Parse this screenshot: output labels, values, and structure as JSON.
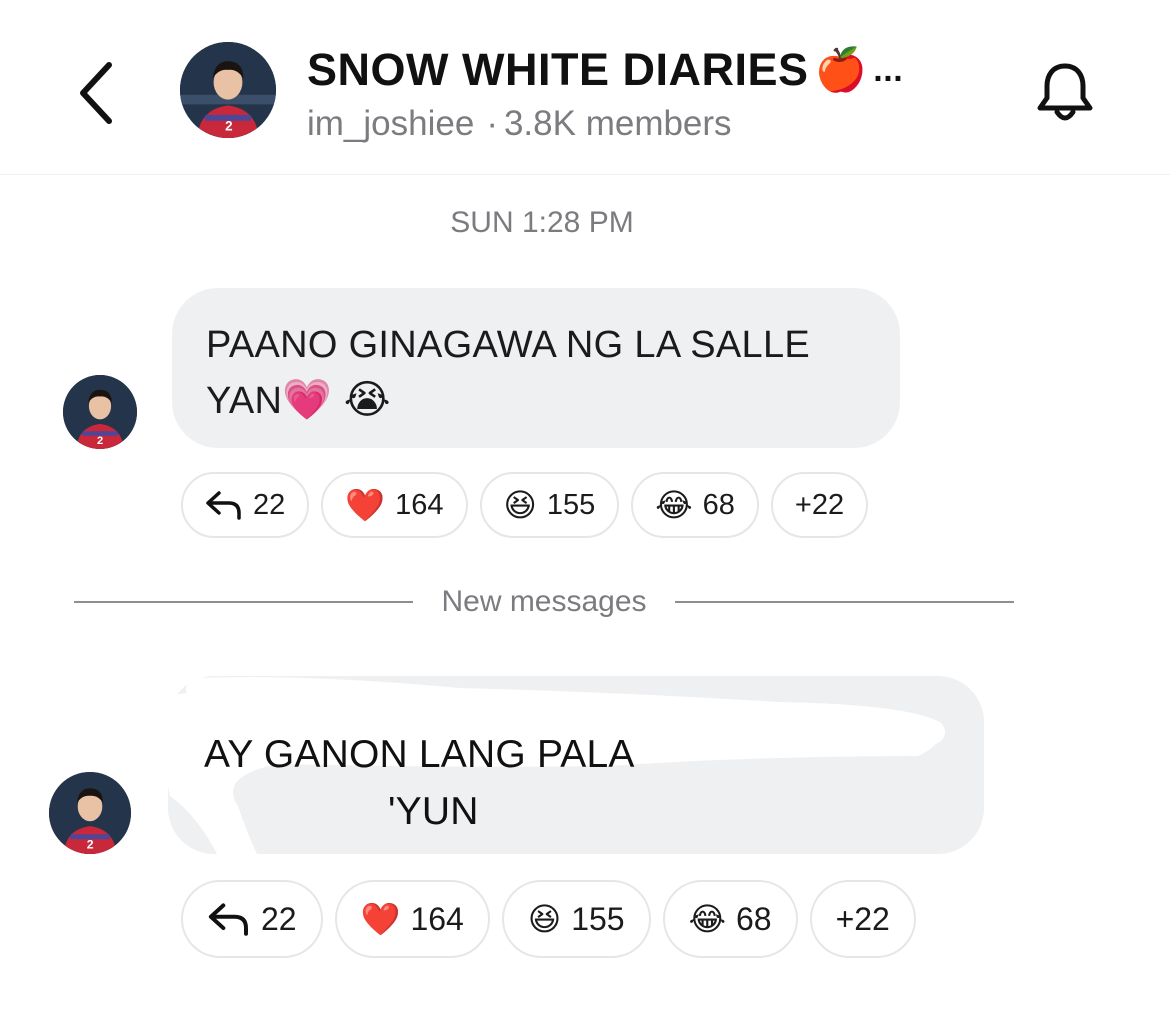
{
  "header": {
    "title": "SNOW WHITE DIARIES",
    "title_emoji": "🍎",
    "title_overflow": "...",
    "username": "im_joshiee",
    "separator": "·",
    "member_count": "3.8K members",
    "back_icon": "chevron-left-icon",
    "bell_icon": "bell-icon"
  },
  "timestamp": "SUN 1:28 PM",
  "messages": [
    {
      "line1": "PAANO GINAGAWA NG LA SALLE",
      "line2_text": "YAN",
      "line2_emojis": "💗 😭",
      "reactions": {
        "reply_icon": "reply-arrow-icon",
        "reply_count": "22",
        "heart_emoji": "❤️",
        "heart_count": "164",
        "grin_emoji": "😆",
        "grin_count": "155",
        "joy_emoji": "😂",
        "joy_count": "68",
        "more": "+22"
      }
    },
    {
      "line1": "AY GANON LANG PALA",
      "line2": "'YUN",
      "reactions": {
        "reply_icon": "reply-arrow-icon",
        "reply_count": "22",
        "heart_emoji": "❤️",
        "heart_count": "164",
        "grin_emoji": "😆",
        "grin_count": "155",
        "joy_emoji": "😂",
        "joy_count": "68",
        "more": "+22"
      }
    }
  ],
  "new_messages_label": "New messages",
  "colors": {
    "bubble_bg": "#eff0f2",
    "muted_text": "#7b7b80",
    "chip_border": "#e6e6e9"
  }
}
